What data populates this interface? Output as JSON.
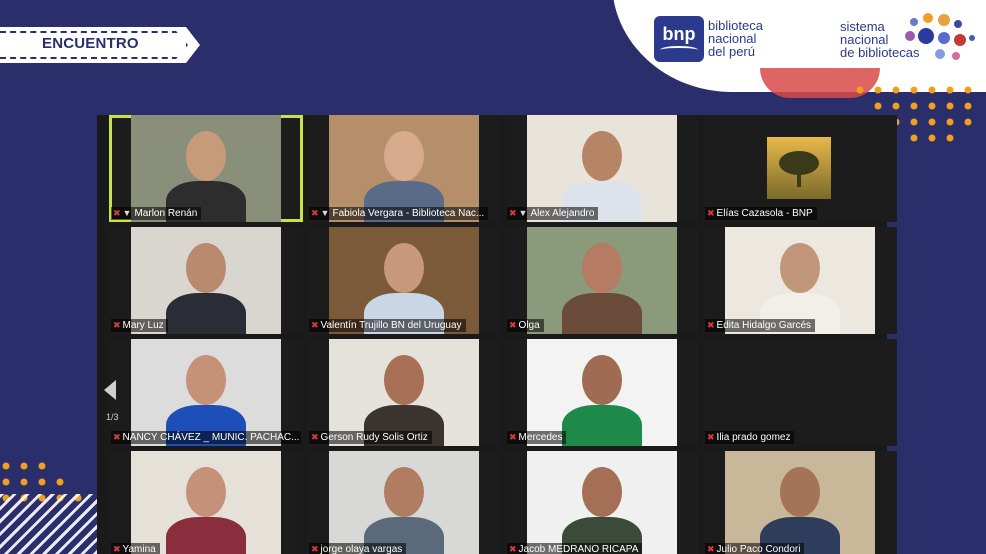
{
  "banner": {
    "label": "ENCUENTRO"
  },
  "logos": {
    "bnp_mark": "bnp",
    "bnp_lines": [
      "biblioteca",
      "nacional",
      "del perú"
    ],
    "snb_lines": [
      "sistema",
      "nacional",
      "de bibliotecas"
    ]
  },
  "gallery": {
    "page_indicator": "1/3",
    "participants": [
      {
        "name": "Marlon Renán",
        "muted": true,
        "pinned": true,
        "active": true,
        "bg": "#8a8f7a",
        "skin": "#c79a7a",
        "shirt": "#2d2d2d"
      },
      {
        "name": "Fabiola Vergara - Biblioteca Nac...",
        "muted": true,
        "pinned": true,
        "active": false,
        "bg": "#b48f6a",
        "skin": "#d8ab8c",
        "shirt": "#5a6b8a"
      },
      {
        "name": "Alex Alejandro",
        "muted": true,
        "pinned": true,
        "active": false,
        "bg": "#e9e4d9",
        "skin": "#b88466",
        "shirt": "#dde3ea"
      },
      {
        "name": "Elías Cazasola - BNP",
        "muted": true,
        "pinned": false,
        "active": false,
        "bg": "#000000",
        "skin": "",
        "shirt": ""
      },
      {
        "name": "Mary Luz",
        "muted": true,
        "pinned": false,
        "active": false,
        "bg": "#d9d6cf",
        "skin": "#b98a6e",
        "shirt": "#2a2d36"
      },
      {
        "name": "Valentín Trujillo BN del Uruguay",
        "muted": true,
        "pinned": false,
        "active": false,
        "bg": "#7b5a3a",
        "skin": "#c8987a",
        "shirt": "#c9d6e6"
      },
      {
        "name": "Olga",
        "muted": true,
        "pinned": false,
        "active": false,
        "bg": "#8a9a7a",
        "skin": "#b57c63",
        "shirt": "#6a4b3a"
      },
      {
        "name": "Edita Hidalgo Garcés",
        "muted": true,
        "pinned": false,
        "active": false,
        "bg": "#ece7df",
        "skin": "#c2967a",
        "shirt": "#f2efe9"
      },
      {
        "name": "NANCY CHÁVEZ _ MUNIC. PACHAC...",
        "muted": true,
        "pinned": false,
        "active": false,
        "bg": "#dcdcdc",
        "skin": "#c59278",
        "shirt": "#1e4fb8"
      },
      {
        "name": "Gerson Rudy Solis Ortiz",
        "muted": true,
        "pinned": false,
        "active": false,
        "bg": "#e5e2dc",
        "skin": "#a87156",
        "shirt": "#3a3330"
      },
      {
        "name": "Mercedes",
        "muted": true,
        "pinned": false,
        "active": false,
        "bg": "#f3f3f3",
        "skin": "#9f6b52",
        "shirt": "#1e8a4a"
      },
      {
        "name": "Ilia prado gomez",
        "muted": true,
        "pinned": false,
        "active": false,
        "bg": "#1c1c1c",
        "skin": "",
        "shirt": ""
      },
      {
        "name": "Yamina",
        "muted": true,
        "pinned": false,
        "active": false,
        "bg": "#e6e1d8",
        "skin": "#c6917a",
        "shirt": "#8a2e3e"
      },
      {
        "name": "jorge olaya vargas",
        "muted": true,
        "pinned": false,
        "active": false,
        "bg": "#d8d8d6",
        "skin": "#b07c62",
        "shirt": "#5a6a7a"
      },
      {
        "name": "Jacob MEDRANO RICAPA",
        "muted": true,
        "pinned": false,
        "active": false,
        "bg": "#f0f0f0",
        "skin": "#a56f55",
        "shirt": "#3c4a3a"
      },
      {
        "name": "Julio Paco Condori",
        "muted": true,
        "pinned": false,
        "active": false,
        "bg": "#c9b79a",
        "skin": "#a57458",
        "shirt": "#2e3d5c"
      }
    ]
  },
  "colors": {
    "background": "#2a2f6b",
    "active_speaker": "#c9e24a",
    "muted_icon": "#e23b3b",
    "accent_orange": "#f0a020"
  }
}
